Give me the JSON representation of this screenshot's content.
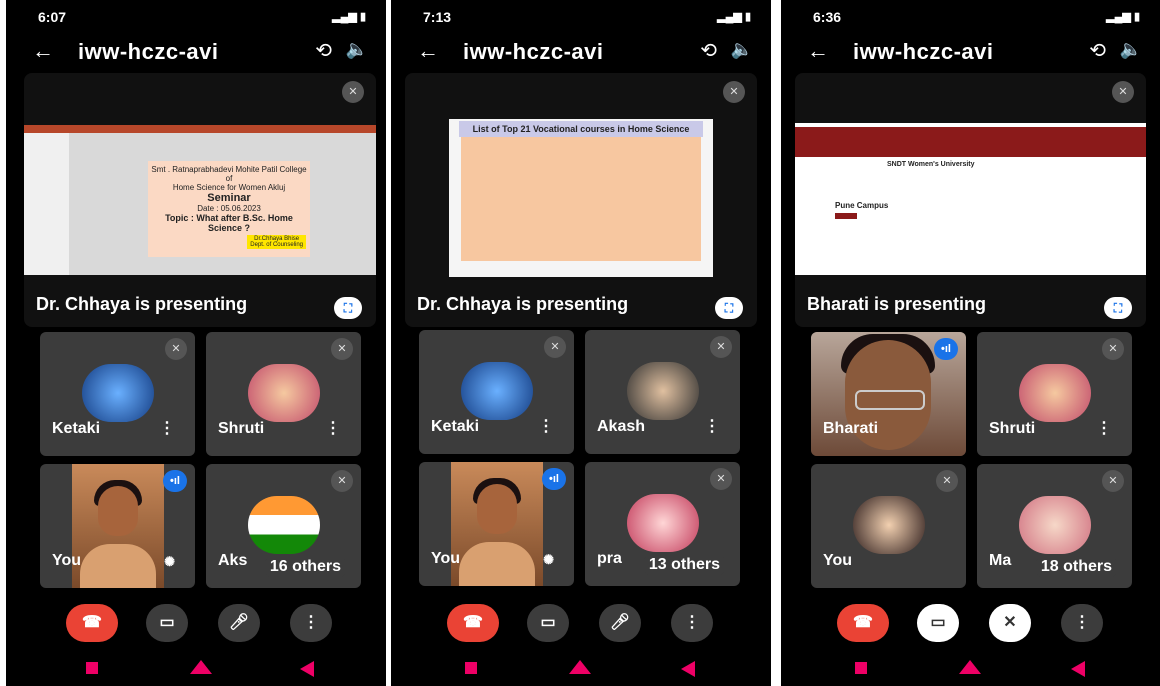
{
  "panels": [
    {
      "time": "6:07",
      "meeting": "iww-hczc-avi",
      "presenting": "Dr. Chhaya is presenting",
      "slide_lines": [
        "Smt . Ratnaprabhadevi Mohite Patil College of",
        "Home Science for Women Akluj",
        "Seminar",
        "Date : 05.06.2023",
        "Topic : What after B.Sc. Home",
        "Science ?",
        "Dr.Chhaya Bhise",
        "Dept. of Counseling"
      ],
      "tiles": [
        {
          "name": "Ketaki"
        },
        {
          "name": "Shruti"
        },
        {
          "name": "You"
        },
        {
          "name": "Aks",
          "others": "16 others"
        }
      ]
    },
    {
      "time": "7:13",
      "meeting": "iww-hczc-avi",
      "presenting": "Dr. Chhaya is presenting",
      "slide_title": "List of Top 21 Vocational courses in Home Science",
      "tiles": [
        {
          "name": "Ketaki"
        },
        {
          "name": "Akash"
        },
        {
          "name": "You"
        },
        {
          "name": "pra",
          "others": "13 others"
        }
      ]
    },
    {
      "time": "6:36",
      "meeting": "iww-hczc-avi",
      "presenting": "Bharati is presenting",
      "site_title": "SNDT Women's University",
      "site_sub": "Pune Campus",
      "tiles": [
        {
          "name": "Bharati"
        },
        {
          "name": "Shruti"
        },
        {
          "name": "You"
        },
        {
          "name": "Ma",
          "others": "18 others"
        }
      ]
    }
  ],
  "icons": {
    "back": "back-arrow-icon",
    "flip": "flip-camera-icon",
    "speaker": "speaker-icon",
    "mute": "mic-off-icon",
    "fullscreen": "fullscreen-icon",
    "end": "end-call-icon",
    "camera": "camera-icon",
    "mic": "mic-icon",
    "more": "more-icon"
  },
  "colors": {
    "end_call": "#ea4335",
    "accent": "#1a73e8",
    "nav": "#e00066"
  }
}
